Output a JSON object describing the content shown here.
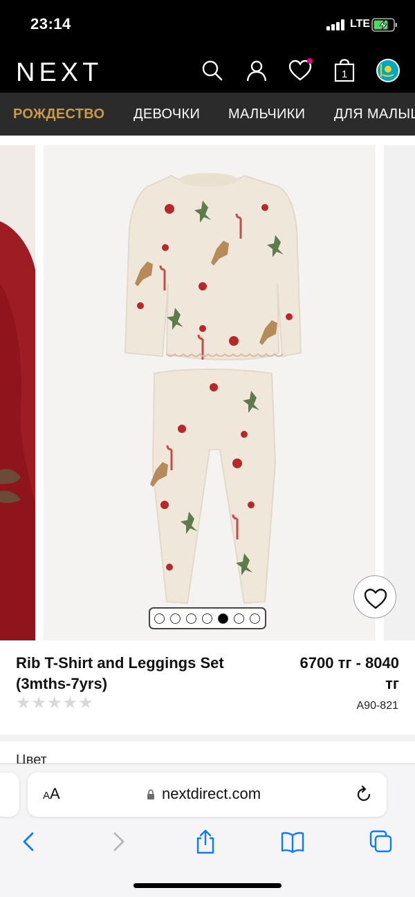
{
  "status_bar": {
    "time": "23:14",
    "network": "LTE"
  },
  "header": {
    "logo": "NEXT",
    "cart_count": "1"
  },
  "categories": [
    {
      "label": "РОЖДЕСТВО",
      "active": true
    },
    {
      "label": "ДЕВОЧКИ",
      "active": false
    },
    {
      "label": "МАЛЬЧИКИ",
      "active": false
    },
    {
      "label": "ДЛЯ МАЛЫШЕЙ",
      "active": false
    }
  ],
  "gallery": {
    "dot_count": 7,
    "active_dot": 5
  },
  "product": {
    "title_line1": "Rib T-Shirt and Leggings Set",
    "title_line2": "(3mths-7yrs)",
    "price_line1": "6700 тг - 8040",
    "price_line2": "тг",
    "sku": "A90-821",
    "rating_stars": 5,
    "rating_value": 0
  },
  "color_section": {
    "label": "Цвет"
  },
  "browser": {
    "aa_label_small": "A",
    "aa_label_large": "A",
    "url": "nextdirect.com"
  },
  "colors": {
    "accent": "#c69a4a",
    "header_bg": "#000000",
    "nav_bg": "#2b2b2b",
    "ios_blue": "#0a7aff"
  }
}
